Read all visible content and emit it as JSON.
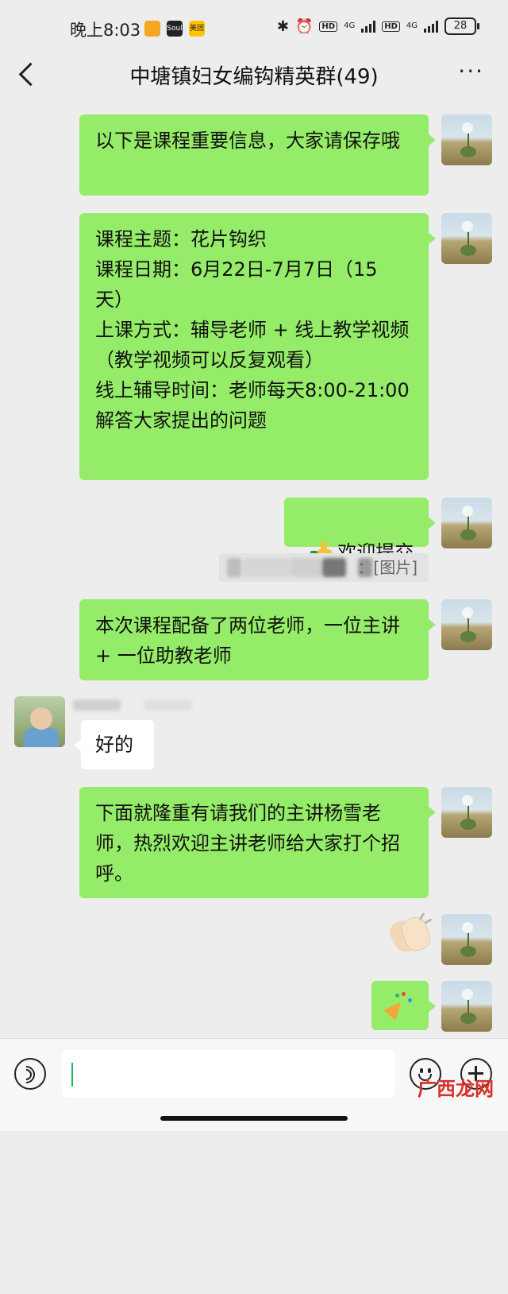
{
  "status_bar": {
    "time": "晚上8:03",
    "apps": [
      "Soul",
      "美团"
    ],
    "net1": "4G",
    "net2": "4G",
    "hd": "HD",
    "battery": "28"
  },
  "nav": {
    "title": "中塘镇妇女编钩精英群(49)",
    "more": "···"
  },
  "messages": [
    {
      "side": "me",
      "text": "以下是课程重要信息，大家请保存哦"
    },
    {
      "side": "me",
      "text": "课程主题：花片钩织\n课程日期：6月22日-7月7日（15天）\n上课方式：辅导老师 + 线上教学视频（教学视频可以反复观看）\n线上辅导时间：老师每天8:00-21:00解答大家提出的问题"
    },
    {
      "side": "me",
      "text": "欢迎提交",
      "emoji": "thumbs-up"
    },
    {
      "side": "me",
      "text": "本次课程配备了两位老师，一位主讲 + 一位助教老师"
    },
    {
      "side": "other",
      "text": "好的"
    },
    {
      "side": "me",
      "text": "下面就隆重有请我们的主讲杨雪老师，热烈欢迎主讲老师给大家打个招呼。"
    },
    {
      "side": "me",
      "emoji": "clapping-hands"
    },
    {
      "side": "me",
      "emoji": "party-popper"
    }
  ],
  "quote": {
    "text": "：[图片]"
  },
  "watermark": "广西龙网",
  "colors": {
    "bubble_me": "#95ec69",
    "bubble_other": "#ffffff",
    "background": "#ededed",
    "caret": "#07c160"
  }
}
